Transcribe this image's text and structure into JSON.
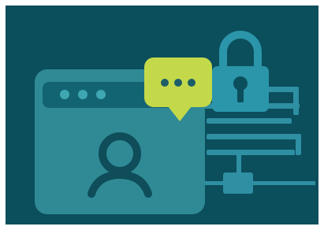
{
  "palette": {
    "frame": "#ffffff",
    "background": "#0b4e5c",
    "window_body": "#2f8a96",
    "window_bar": "#136473",
    "window_dots": "#3ea7b2",
    "avatar": "#0e4d59",
    "chat_bubble": "#c4d94a",
    "chat_dots": "#1d5d67",
    "lock": "#2b95a9",
    "lock_keyhole": "#0b4e5c",
    "lines": "#2f8fa3",
    "network_node": "#2f8fa3"
  },
  "icons": {
    "window": "browser-window-icon",
    "avatar": "user-avatar-icon",
    "chat": "chat-bubble-icon",
    "lock": "padlock-icon",
    "network": "network-node-icon"
  },
  "chat_dot_count": 3,
  "window_dot_count": 3
}
